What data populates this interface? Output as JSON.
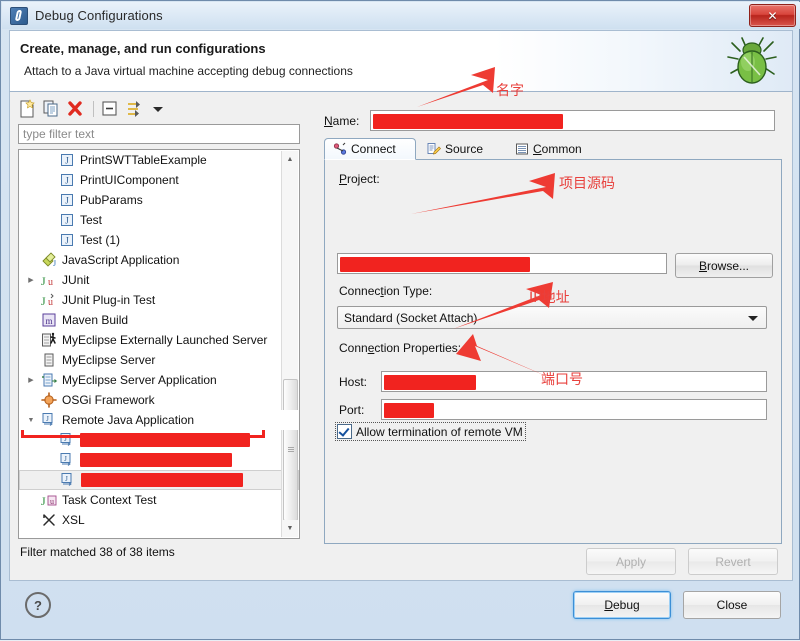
{
  "window": {
    "title": "Debug Configurations",
    "icon": "eclipse-debug-icon",
    "close_label": "✕"
  },
  "header": {
    "title": "Create, manage, and run configurations",
    "subtitle": "Attach to a Java virtual machine accepting debug connections",
    "icon": "green-bug-icon"
  },
  "left_pane": {
    "toolbar": [
      {
        "name": "new-launch-configuration-icon",
        "tooltip": "New launch configuration"
      },
      {
        "name": "duplicate-icon",
        "tooltip": "Duplicate"
      },
      {
        "name": "delete-icon",
        "tooltip": "Delete"
      },
      {
        "name": "collapse-all-icon",
        "tooltip": "Collapse All"
      },
      {
        "name": "filter-icon",
        "tooltip": "Filter launch configurations"
      },
      {
        "name": "dropdown-arrow-icon",
        "tooltip": "Menu"
      }
    ],
    "filter": {
      "placeholder": "type filter text",
      "value": ""
    },
    "tree": [
      {
        "label": "PrintSWTTableExample",
        "icon": "java-app-icon",
        "indent": 2,
        "twisty": "",
        "redacted": false
      },
      {
        "label": "PrintUIComponent",
        "icon": "java-app-icon",
        "indent": 2,
        "twisty": "",
        "redacted": false
      },
      {
        "label": "PubParams",
        "icon": "java-app-icon",
        "indent": 2,
        "twisty": "",
        "redacted": false
      },
      {
        "label": "Test",
        "icon": "java-app-icon",
        "indent": 2,
        "twisty": "",
        "redacted": false
      },
      {
        "label": "Test (1)",
        "icon": "java-app-icon",
        "indent": 2,
        "twisty": "",
        "redacted": false
      },
      {
        "label": "JavaScript Application",
        "icon": "javascript-icon",
        "indent": 1,
        "twisty": "",
        "redacted": false
      },
      {
        "label": "JUnit",
        "icon": "junit-icon",
        "indent": 1,
        "twisty": "▶",
        "redacted": false
      },
      {
        "label": "JUnit Plug-in Test",
        "icon": "junit-plugin-icon",
        "indent": 1,
        "twisty": "",
        "redacted": false
      },
      {
        "label": "Maven Build",
        "icon": "maven-icon",
        "indent": 1,
        "twisty": "",
        "redacted": false
      },
      {
        "label": "MyEclipse Externally Launched Server",
        "icon": "myeclipse-ext-server-icon",
        "indent": 1,
        "twisty": "",
        "redacted": false
      },
      {
        "label": "MyEclipse Server",
        "icon": "myeclipse-server-icon",
        "indent": 1,
        "twisty": "",
        "redacted": false
      },
      {
        "label": "MyEclipse Server Application",
        "icon": "myeclipse-server-app-icon",
        "indent": 1,
        "twisty": "▶",
        "redacted": false
      },
      {
        "label": "OSGi Framework",
        "icon": "osgi-icon",
        "indent": 1,
        "twisty": "",
        "redacted": false
      },
      {
        "label": "Remote Java Application",
        "icon": "remote-java-app-icon",
        "indent": 1,
        "twisty": "▼",
        "redacted": false,
        "highlighted": true
      },
      {
        "label": "",
        "icon": "remote-java-app-icon",
        "indent": 2,
        "twisty": "",
        "redacted": true,
        "redact_width": 170
      },
      {
        "label": "",
        "icon": "remote-java-app-icon",
        "indent": 2,
        "twisty": "",
        "redacted": true,
        "redact_width": 152
      },
      {
        "label": "",
        "icon": "remote-java-app-icon",
        "indent": 2,
        "twisty": "",
        "redacted": true,
        "redact_width": 162,
        "selected": true
      },
      {
        "label": "Task Context Test",
        "icon": "task-context-test-icon",
        "indent": 1,
        "twisty": "",
        "redacted": false
      },
      {
        "label": "XSL",
        "icon": "xsl-icon",
        "indent": 1,
        "twisty": "",
        "redacted": false
      }
    ],
    "status": "Filter matched 38 of 38 items"
  },
  "right_pane": {
    "name_label": "Name:",
    "name_value": "",
    "tabs": [
      {
        "label": "Connect",
        "icon": "connect-icon",
        "active": true
      },
      {
        "label": "Source",
        "icon": "source-icon",
        "active": false
      },
      {
        "label": "Common",
        "icon": "common-icon",
        "active": false
      }
    ],
    "project_label": "Project:",
    "project_value": "",
    "browse_label": "Browse...",
    "connection_type_label": "Connection Type:",
    "connection_type_value": "Standard (Socket Attach)",
    "connection_properties_label": "Connection Properties:",
    "host_label": "Host:",
    "host_value": "",
    "port_label": "Port:",
    "port_value": "",
    "allow_termination_label": "Allow termination of remote VM",
    "allow_termination_checked": true,
    "apply_label": "Apply",
    "revert_label": "Revert"
  },
  "footer": {
    "help_label": "?",
    "debug_label": "Debug",
    "close_label": "Close"
  },
  "annotations": [
    {
      "name": "annotation-name",
      "text": "名字"
    },
    {
      "name": "annotation-project-source",
      "text": "项目源码"
    },
    {
      "name": "annotation-ip-address",
      "text": "IP地址"
    },
    {
      "name": "annotation-port-number",
      "text": "端口号"
    }
  ],
  "colors": {
    "annotation_red": "#e8403c",
    "redaction_red": "#f1231f",
    "title_blue": "#cfe0f0",
    "accent_blue": "#3c8fd6"
  }
}
